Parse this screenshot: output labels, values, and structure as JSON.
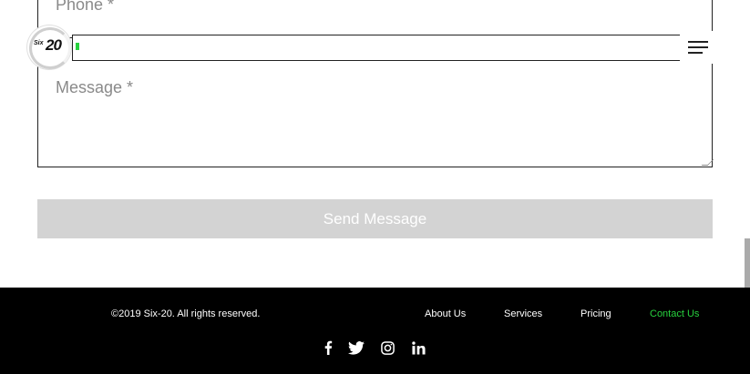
{
  "form": {
    "phone_label": "Phone *",
    "message_label": "Message *",
    "send_label": "Send Message"
  },
  "header": {
    "logo_small": "Six",
    "logo_big": "20",
    "progress_fraction": 0.006
  },
  "footer": {
    "copyright": "©2019 Six-20. All rights reserved.",
    "nav": [
      "About Us",
      "Services",
      "Pricing",
      "Contact Us"
    ],
    "social": [
      "facebook-icon",
      "twitter-icon",
      "instagram-icon",
      "linkedin-icon"
    ]
  },
  "colors": {
    "accent": "#27d13e",
    "button_bg": "#d3d3d3",
    "footer_bg": "#000000"
  }
}
